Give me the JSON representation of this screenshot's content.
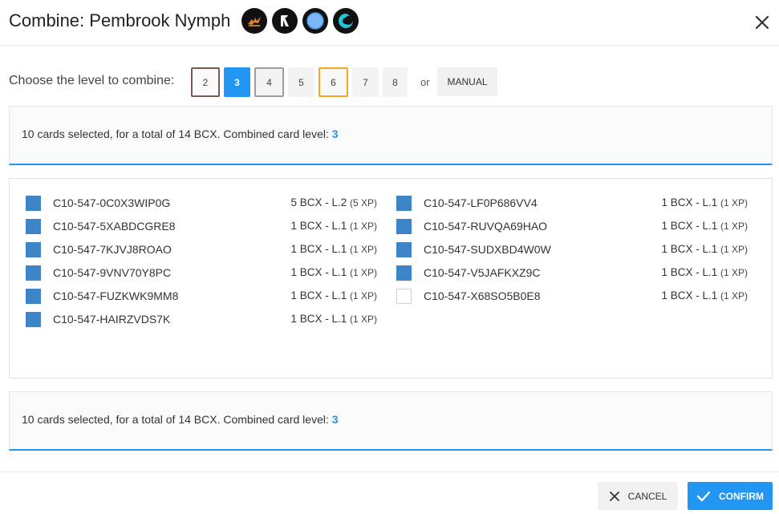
{
  "dialog": {
    "title": "Combine: Pembrook Nymph",
    "element_icons": [
      "fire-splinter-icon",
      "arrow-up-icon",
      "water-circle-icon",
      "life-swirl-icon"
    ]
  },
  "level_select": {
    "label": "Choose the level to combine:",
    "levels": [
      "2",
      "3",
      "4",
      "5",
      "6",
      "7",
      "8"
    ],
    "selected": "3",
    "or_text": "or",
    "manual_label": "MANUAL"
  },
  "summary": {
    "text": "10 cards selected, for a total of 14 BCX. Combined card level:",
    "level": "3"
  },
  "cards_left": [
    {
      "id": "C10-547-0C0X3WIP0G",
      "bcx": "5 BCX - L.2",
      "xp": "(5 XP)",
      "checked": true
    },
    {
      "id": "C10-547-5XABDCGRE8",
      "bcx": "1 BCX - L.1",
      "xp": "(1 XP)",
      "checked": true
    },
    {
      "id": "C10-547-7KJVJ8ROAO",
      "bcx": "1 BCX - L.1",
      "xp": "(1 XP)",
      "checked": true
    },
    {
      "id": "C10-547-9VNV70Y8PC",
      "bcx": "1 BCX - L.1",
      "xp": "(1 XP)",
      "checked": true
    },
    {
      "id": "C10-547-FUZKWK9MM8",
      "bcx": "1 BCX - L.1",
      "xp": "(1 XP)",
      "checked": true
    },
    {
      "id": "C10-547-HAIRZVDS7K",
      "bcx": "1 BCX - L.1",
      "xp": "(1 XP)",
      "checked": true
    }
  ],
  "cards_right": [
    {
      "id": "C10-547-LF0P686VV4",
      "bcx": "1 BCX - L.1",
      "xp": "(1 XP)",
      "checked": true
    },
    {
      "id": "C10-547-RUVQA69HAO",
      "bcx": "1 BCX - L.1",
      "xp": "(1 XP)",
      "checked": true
    },
    {
      "id": "C10-547-SUDXBD4W0W",
      "bcx": "1 BCX - L.1",
      "xp": "(1 XP)",
      "checked": true
    },
    {
      "id": "C10-547-V5JAFKXZ9C",
      "bcx": "1 BCX - L.1",
      "xp": "(1 XP)",
      "checked": true
    },
    {
      "id": "C10-547-X68SO5B0E8",
      "bcx": "1 BCX - L.1",
      "xp": "(1 XP)",
      "checked": false
    }
  ],
  "footer": {
    "cancel_label": "CANCEL",
    "confirm_label": "CONFIRM"
  },
  "colors": {
    "accent": "#2196f3",
    "checkbox": "#3d85c6",
    "level_2_border": "#7b5a50",
    "level_6_border": "#f5a623"
  }
}
